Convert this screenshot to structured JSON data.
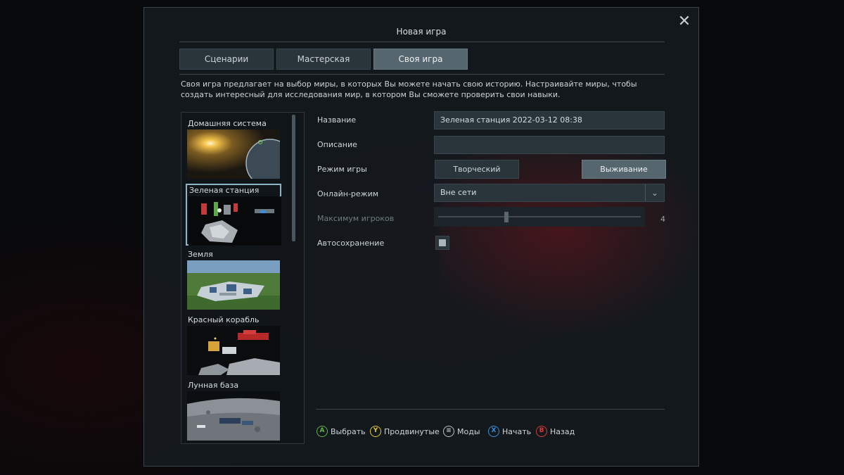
{
  "dialog": {
    "title": "Новая игра"
  },
  "tabs": [
    {
      "label": "Сценарии"
    },
    {
      "label": "Мастерская"
    },
    {
      "label": "Своя игра"
    }
  ],
  "description": "Своя игра предлагает на выбор миры, в которых Вы можете начать свою историю. Настраивайте миры, чтобы создать интересный для исследования мир, в котором Вы сможете проверить свои навыки.",
  "worlds": [
    {
      "label": "Домашняя система"
    },
    {
      "label": "Зеленая станция"
    },
    {
      "label": "Земля"
    },
    {
      "label": "Красный корабль"
    },
    {
      "label": "Лунная база"
    }
  ],
  "settings": {
    "name_label": "Название",
    "name_value": "Зеленая станция 2022-03-12 08:38",
    "description_label": "Описание",
    "description_value": "",
    "game_mode_label": "Режим игры",
    "mode_creative": "Творческий",
    "mode_survival": "Выживание",
    "online_label": "Онлайн-режим",
    "online_value": "Вне сети",
    "max_players_label": "Максимум игроков",
    "max_players_value": "4",
    "autosave_label": "Автосохранение"
  },
  "hints": [
    {
      "key": "A",
      "label": "Выбрать",
      "color": "#5fb346"
    },
    {
      "key": "Y",
      "label": "Продвинутые",
      "color": "#e0c53a"
    },
    {
      "key": "≡",
      "label": "Моды",
      "color": "#b9c2c7"
    },
    {
      "key": "X",
      "label": "Начать",
      "color": "#3a8fd8"
    },
    {
      "key": "B",
      "label": "Назад",
      "color": "#d63a3a"
    }
  ],
  "colors": {
    "active_tab": "#56666e",
    "selected_border": "#8fb5c4"
  }
}
